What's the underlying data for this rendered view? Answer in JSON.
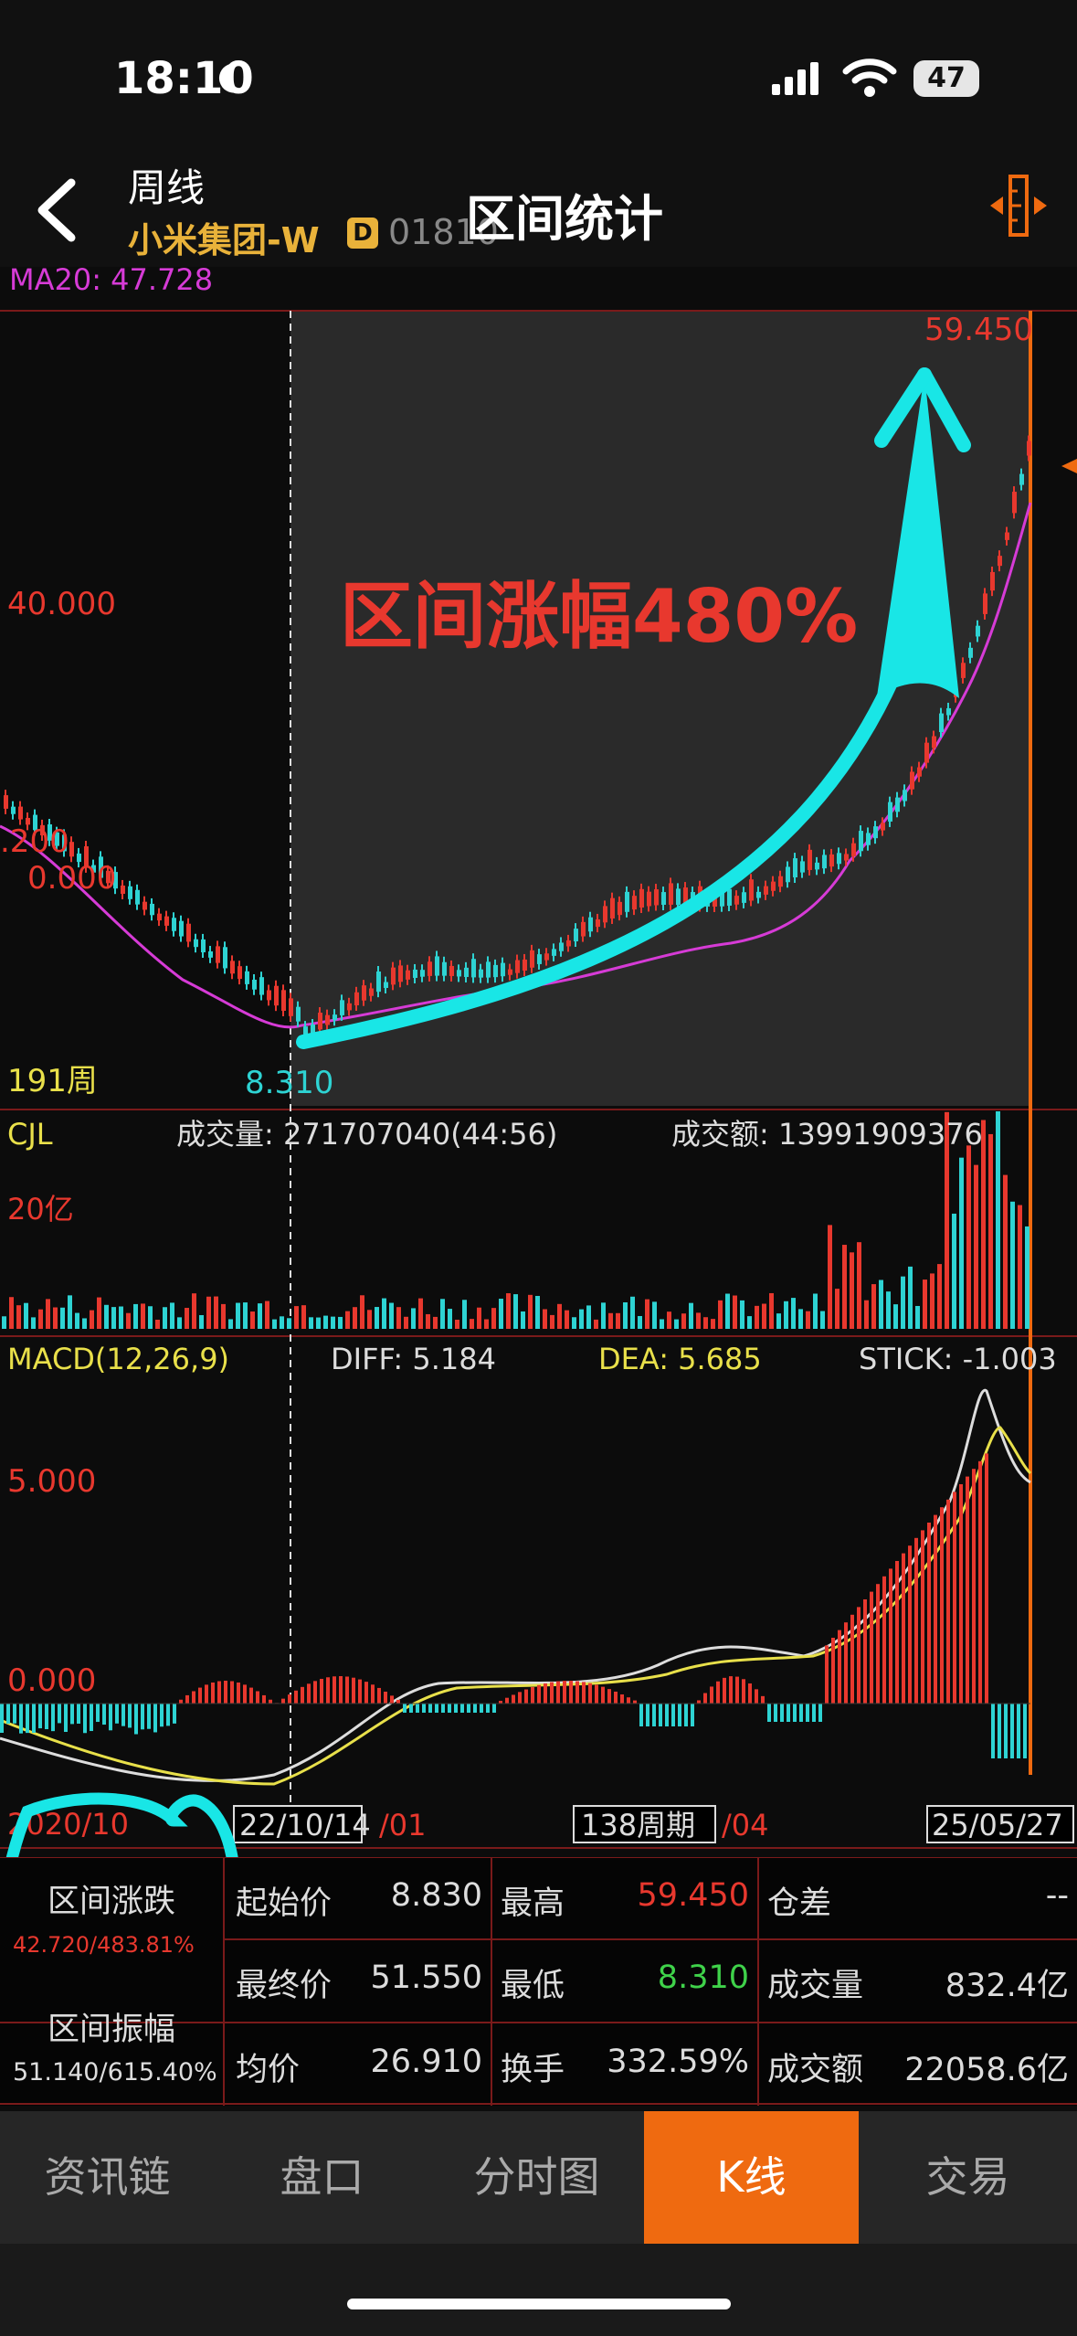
{
  "status": {
    "time": "18:10",
    "battery": "47"
  },
  "header": {
    "period": "周线",
    "stock_name": "小米集团-W",
    "badge": "D",
    "stock_code": "01810",
    "title": "区间统计"
  },
  "chart": {
    "ma_label": "MA20: 47.728",
    "price_high": "59.450",
    "price_low": "8.310",
    "y_40": "40.000",
    "y_200": ".200",
    "y_000": "0.000",
    "count_label": "191周",
    "annotation": "区间涨幅480%",
    "volume_label": "CJL",
    "volume_text": "成交量: 271707040(44:56)",
    "amount_text": "成交额: 13991909376",
    "volume_axis": "20亿",
    "macd_label": "MACD(12,26,9)",
    "diff": "DIFF: 5.184",
    "dea": "DEA: 5.685",
    "stick": "STICK: -1.003",
    "macd_y5": "5.000",
    "macd_y0": "0.000",
    "date_left": "2020/10",
    "date_start": "22/10/14",
    "date_mid1": "/01",
    "period_count": "138周期",
    "date_mid2": "/04",
    "date_end": "25/05/27",
    "colors": {
      "up": "#e8382e",
      "down": "#2ed3d3",
      "ma": "#d63bd6",
      "accent": "#ef6a10",
      "annot": "#19e6e6"
    }
  },
  "stats": {
    "range_change_label": "区间涨跌",
    "range_change_value": "42.720/483.81%",
    "range_amp_label": "区间振幅",
    "range_amp_value": "51.140/615.40%",
    "rows": [
      [
        "起始价",
        "8.830",
        "最高",
        "59.450",
        "仓差",
        "--"
      ],
      [
        "最终价",
        "51.550",
        "最低",
        "8.310",
        "成交量",
        "832.4亿"
      ],
      [
        "均价",
        "26.910",
        "换手",
        "332.59%",
        "成交额",
        "22058.6亿"
      ]
    ]
  },
  "tabs": [
    "资讯链",
    "盘口",
    "分时图",
    "K线",
    "交易"
  ],
  "active_tab": "K线"
}
